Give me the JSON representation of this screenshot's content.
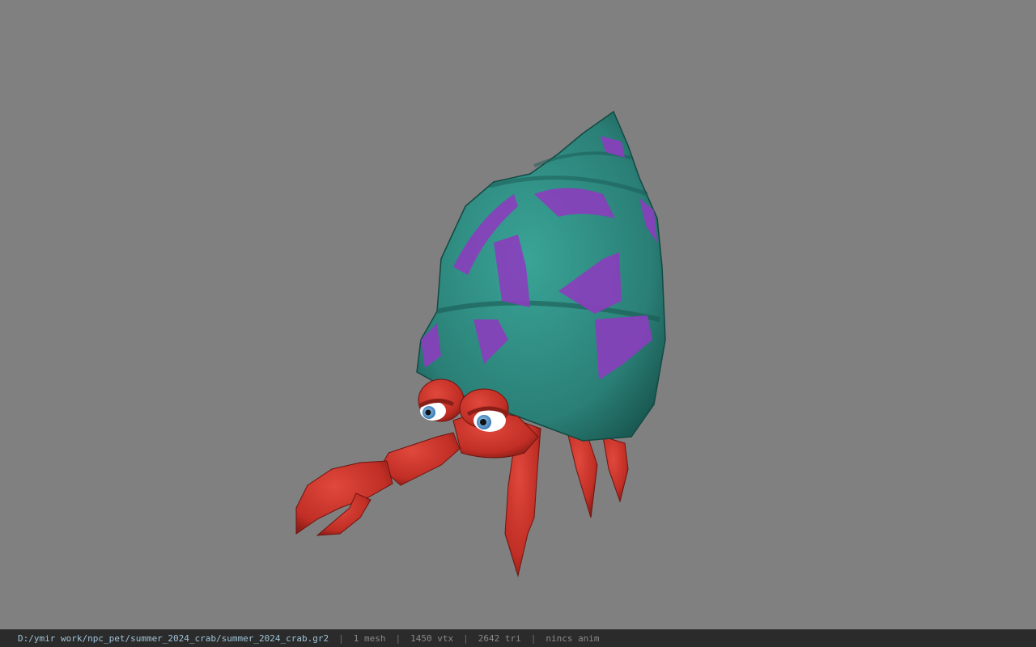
{
  "viewport": {
    "background": "#808080",
    "model_name": "hermit-crab-model"
  },
  "status_bar": {
    "file_path": "D:/ymir work/npc_pet/summer_2024_crab/summer_2024_crab.gr2",
    "sep1": "|",
    "mesh": "1 mesh",
    "sep2": "|",
    "vertices": "1450 vtx",
    "sep3": "|",
    "triangles": "2642 tri",
    "sep4": "|",
    "animation": "nincs anim"
  },
  "colors": {
    "shell": "#2f8a80",
    "shell_dark": "#1f5f58",
    "shell_stripe": "#8a3dbb",
    "crab_red": "#c8332a",
    "crab_dark": "#8a1f18",
    "eye_white": "#ffffff",
    "eye_iris": "#3a86c8"
  }
}
